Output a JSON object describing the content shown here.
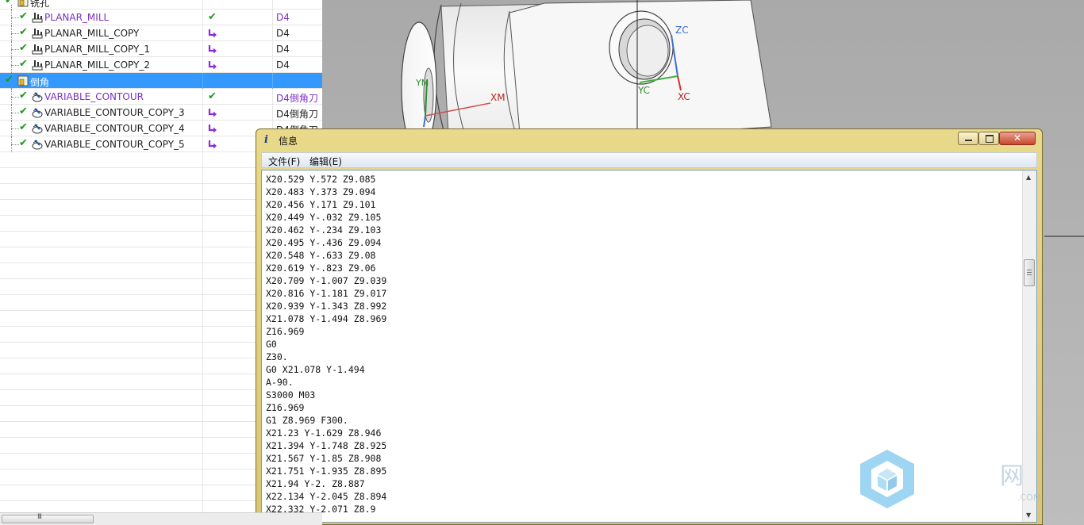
{
  "navigator": {
    "rows": [
      {
        "name": "铣孔",
        "status": "",
        "tool": "",
        "icon": "program-group-icon",
        "level": 0,
        "selected": false,
        "tool_purple": false
      },
      {
        "name": "PLANAR_MILL",
        "status": "check",
        "tool": "D4",
        "icon": "planar-mill-icon",
        "level": 1,
        "selected": false,
        "purple": true,
        "tool_purple": true
      },
      {
        "name": "PLANAR_MILL_COPY",
        "status": "arrow",
        "tool": "D4",
        "icon": "planar-mill-icon",
        "level": 1,
        "selected": false
      },
      {
        "name": "PLANAR_MILL_COPY_1",
        "status": "arrow",
        "tool": "D4",
        "icon": "planar-mill-icon",
        "level": 1,
        "selected": false
      },
      {
        "name": "PLANAR_MILL_COPY_2",
        "status": "arrow",
        "tool": "D4",
        "icon": "planar-mill-icon",
        "level": 1,
        "selected": false
      },
      {
        "name": "倒角",
        "status": "",
        "tool": "",
        "icon": "program-group-icon",
        "level": 0,
        "selected": true
      },
      {
        "name": "VARIABLE_CONTOUR",
        "status": "check",
        "tool": "D4倒角刀",
        "icon": "variable-contour-icon",
        "level": 1,
        "selected": false,
        "purple": true,
        "tool_purple": true
      },
      {
        "name": "VARIABLE_CONTOUR_COPY_3",
        "status": "arrow",
        "tool": "D4倒角刀",
        "icon": "variable-contour-icon",
        "level": 1,
        "selected": false
      },
      {
        "name": "VARIABLE_CONTOUR_COPY_4",
        "status": "arrow",
        "tool": "D4倒角刀",
        "icon": "variable-contour-icon",
        "level": 1,
        "selected": false
      },
      {
        "name": "VARIABLE_CONTOUR_COPY_5",
        "status": "arrow",
        "tool": "",
        "icon": "variable-contour-icon",
        "level": 1,
        "selected": false
      }
    ],
    "status_check_color": "#1a9a1a",
    "status_arrow_color": "#8a2be2",
    "selected_color": "#3399ff",
    "scroll_grip": "III"
  },
  "viewport": {
    "axis_labels": {
      "xm": "XM",
      "zc": "ZC",
      "yc": "YC",
      "xc": "XC",
      "ym": "YM"
    },
    "background": "#b4b4b4"
  },
  "info_dialog": {
    "title": "信息",
    "icon": "info-i-icon",
    "menu": [
      "文件(F)",
      "编辑(E)"
    ],
    "lines": [
      "X20.529 Y.572 Z9.085",
      "X20.483 Y.373 Z9.094",
      "X20.456 Y.171 Z9.101",
      "X20.449 Y-.032 Z9.105",
      "X20.462 Y-.234 Z9.103",
      "X20.495 Y-.436 Z9.094",
      "X20.548 Y-.633 Z9.08",
      "X20.619 Y-.823 Z9.06",
      "X20.709 Y-1.007 Z9.039",
      "X20.816 Y-1.181 Z9.017",
      "X20.939 Y-1.343 Z8.992",
      "X21.078 Y-1.494 Z8.969",
      "Z16.969",
      "G0",
      "Z30.",
      "G0 X21.078 Y-1.494",
      "A-90.",
      "S3000 M03",
      "Z16.969",
      "G1 Z8.969 F300.",
      "X21.23 Y-1.629 Z8.946",
      "X21.394 Y-1.748 Z8.925",
      "X21.567 Y-1.85 Z8.908",
      "X21.751 Y-1.935 Z8.895",
      "X21.94 Y-2. Z8.887",
      "X22.134 Y-2.045 Z8.894",
      "X22.332 Y-2.071 Z8.9"
    ],
    "title_bar_color": "#e4d385",
    "close_color": "#c9452c"
  },
  "watermark": {
    "text": "网",
    "sub": ".COM"
  }
}
